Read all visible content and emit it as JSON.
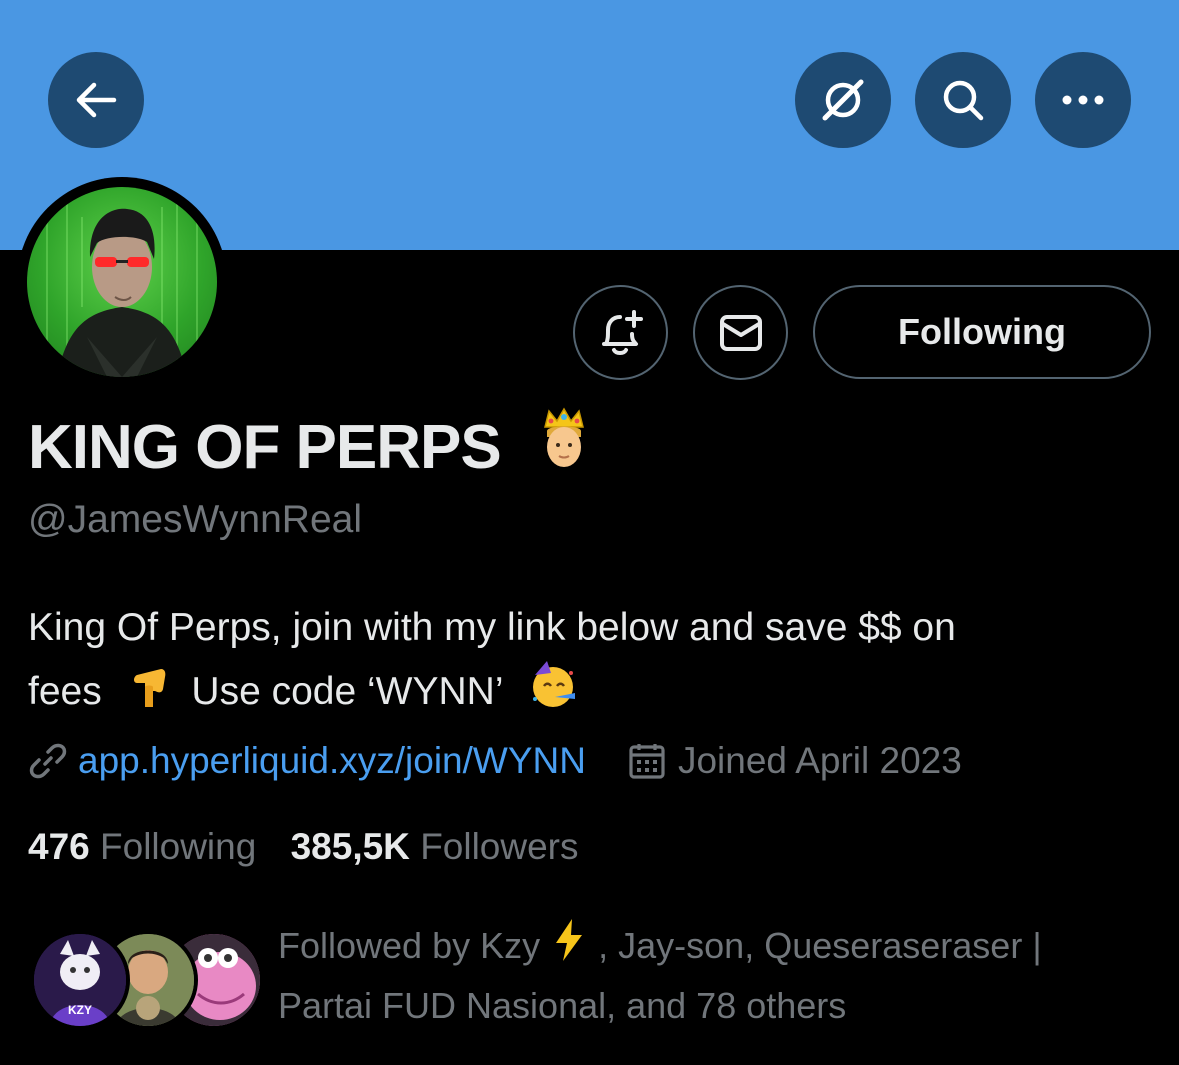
{
  "header": {
    "back_icon": "arrow-left-icon",
    "grok_icon": "grok-icon",
    "search_icon": "search-icon",
    "more_icon": "more-dots-icon",
    "banner_color": "#4a97e3"
  },
  "actions": {
    "notify_icon": "bell-plus-icon",
    "message_icon": "envelope-icon",
    "following_label": "Following"
  },
  "profile": {
    "display_name": "KING OF PERPS",
    "name_emoji": "crown-person-emoji",
    "handle": "@JamesWynnReal",
    "bio_line1": "King Of Perps, join with my link below and save $$ on",
    "bio_line2_a": "fees",
    "bio_line2_b": "Use code ‘WYNN’",
    "website": "app.hyperliquid.xyz/join/WYNN",
    "joined": "Joined April 2023",
    "link_color": "#4a9ef0"
  },
  "stats": {
    "following_count": "476",
    "following_label": "Following",
    "followers_count": "385,5K",
    "followers_label": "Followers"
  },
  "followed_by": {
    "text_a": "Followed by Kzy",
    "text_b": ", Jay-son, Queseraseraser |",
    "text_c": "Partai FUD Nasional, and 78 others",
    "avatar1_label": "KZY"
  }
}
